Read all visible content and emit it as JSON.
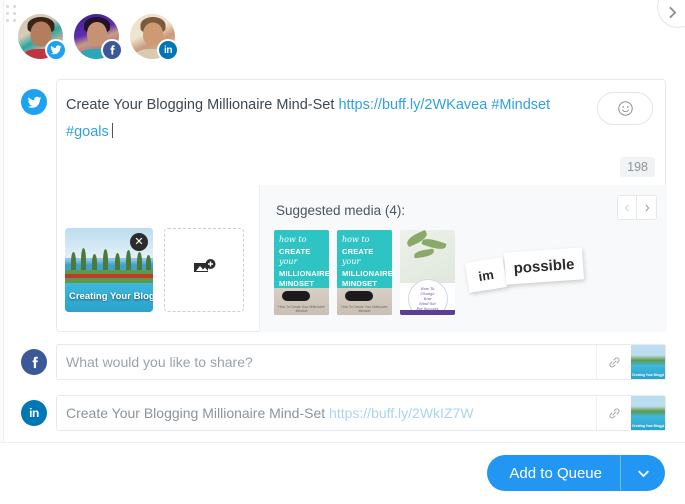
{
  "window": {
    "drag_handle_name": "drag-handle",
    "next_arrow": "›"
  },
  "profiles": [
    {
      "network": "twitter",
      "badge_icon": "twitter-icon",
      "color": "#1da1f2"
    },
    {
      "network": "facebook",
      "badge_icon": "facebook-icon",
      "color": "#3b5998"
    },
    {
      "network": "linkedin",
      "badge_icon": "linkedin-icon",
      "color": "#0077b5",
      "badge_text": "in"
    }
  ],
  "compose": {
    "network": "twitter",
    "text_plain": "Create Your Blogging Millionaire Mind-Set ",
    "link": "https://buff.ly/2WKavea",
    "hashtag_1": "#Mindset",
    "hashtag_2": "#goals",
    "char_count": "198",
    "emoji_button_icon": "emoji-smiley-icon"
  },
  "attached_media": {
    "remove_label": "✕",
    "image_caption": "Creating Your Blogging",
    "add_image_icon": "add-image-icon"
  },
  "suggested_media": {
    "title": "Suggested media (4):",
    "prev_label": "‹",
    "next_label": "›",
    "items": [
      {
        "name": "millionaire-mindset-1",
        "howto": "how to",
        "line1": "CREATE",
        "your": "your",
        "line2": "MILLIONAIRE",
        "line3": "MINDSET",
        "footer": "How To Create Your Millionaire Mindset"
      },
      {
        "name": "millionaire-mindset-2",
        "howto": "how to",
        "line1": "CREATE",
        "your": "your",
        "line2": "MILLIONAIRE",
        "line3": "MINDSET",
        "footer": "How To Create Your Millionaire Mindset"
      },
      {
        "name": "change-your-mindset",
        "circle_line1": "How To",
        "circle_line2": "Change",
        "circle_line3": "Your",
        "circle_line4": "Mind-Set",
        "circle_line5": "For Success"
      },
      {
        "name": "im-possible",
        "scrap_1": "im",
        "scrap_2": "possible"
      }
    ]
  },
  "rows": [
    {
      "network": "facebook",
      "value": "",
      "placeholder": "What would you like to share?",
      "link_icon": "link-icon",
      "thumb_caption": "Creating Your Blogging"
    },
    {
      "network": "linkedin",
      "badge_text": "in",
      "value": "Create Your Blogging Millionaire Mind-Set ",
      "link": "https://buff.ly/2WkIZ7W",
      "link_icon": "link-icon",
      "thumb_caption": "Creating Your Blogging"
    }
  ],
  "footer": {
    "primary_label": "Add to Queue",
    "caret_icon": "chevron-down-icon",
    "accent_color": "#2196f3"
  }
}
